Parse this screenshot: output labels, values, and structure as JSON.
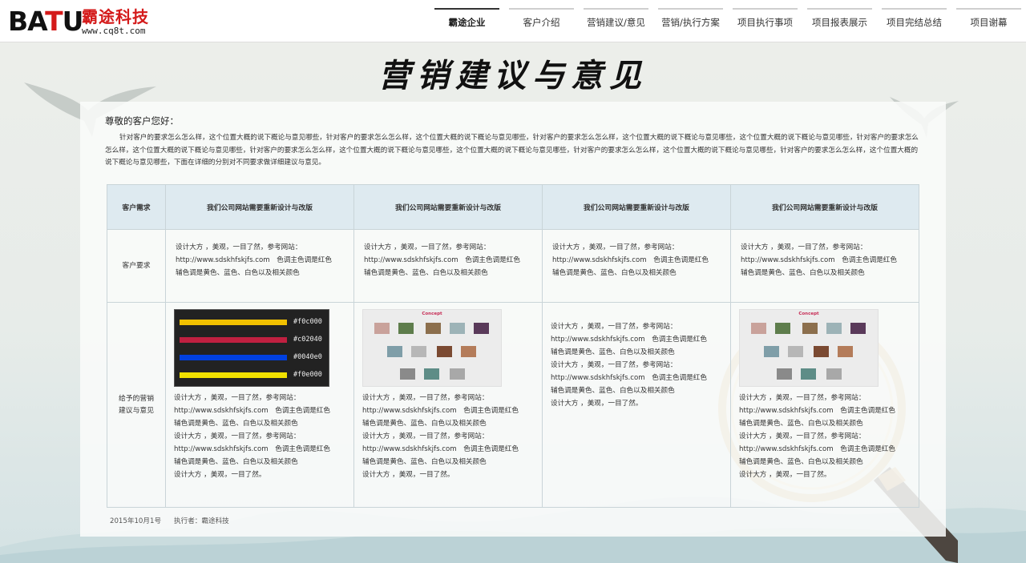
{
  "brand": {
    "logo_text_a": "BA",
    "logo_text_t": "T",
    "logo_text_u": "U",
    "name_cn": "霸途科技",
    "url": "www.cq8t.com"
  },
  "nav": {
    "items": [
      {
        "label": "霸途企业",
        "active": true
      },
      {
        "label": "客户介绍"
      },
      {
        "label": "营销建议/意见"
      },
      {
        "label": "营销/执行方案"
      },
      {
        "label": "项目执行事项"
      },
      {
        "label": "项目报表展示"
      },
      {
        "label": "项目完结总结"
      },
      {
        "label": "项目谢幕"
      }
    ]
  },
  "page": {
    "title": "营销建议与意见",
    "greeting": "尊敬的客户您好：",
    "intro": "针对客户的要求怎么怎么样，这个位置大概的说下概论与意见哪些，针对客户的要求怎么怎么样，这个位置大概的说下概论与意见哪些，针对客户的要求怎么怎么样，这个位置大概的说下概论与意见哪些，这个位置大概的说下概论与意见哪些，针对客户的要求怎么怎么样，这个位置大概的说下概论与意见哪些，针对客户的要求怎么怎么样，这个位置大概的说下概论与意见哪些，这个位置大概的说下概论与意见哪些，针对客户的要求怎么怎么样，这个位置大概的说下概论与意见哪些，针对客户的要求怎么怎么样，这个位置大概的说下概论与意见哪些，下面在详细的分别对不同要求做详细建议与意见。"
  },
  "table": {
    "row_labels": {
      "need": "客户需求",
      "requirement": "客户要求",
      "suggestion": "给予的营销建议与意见"
    },
    "headers": [
      "我们公司网站需要重新设计与改版",
      "我们公司网站需要重新设计与改版",
      "我们公司网站需要重新设计与改版",
      "我们公司网站需要重新设计与改版"
    ],
    "requirement_lines": [
      "设计大方 ，美观，一目了然，参考网站：",
      "http://www.sdskhfskjfs.com　色调主色调是红色",
      "辅色调是黄色、蓝色、白色以及相关颜色"
    ],
    "suggestion_lines": [
      "设计大方 ，美观，一目了然，参考网站：",
      "http://www.sdskhfskjfs.com　色调主色调是红色",
      "辅色调是黄色、蓝色、白色以及相关颜色",
      "设计大方 ，美观，一目了然，参考网站：",
      "http://www.sdskhfskjfs.com　色调主色调是红色",
      "辅色调是黄色、蓝色、白色以及相关颜色",
      "设计大方 ，美观，一目了然。"
    ],
    "swatches": [
      {
        "color": "#f0c000",
        "label": "#f0c000"
      },
      {
        "color": "#c02040",
        "label": "#c02040"
      },
      {
        "color": "#0040e0",
        "label": "#0040e0"
      },
      {
        "color": "#f0e000",
        "label": "#f0e000"
      }
    ],
    "concept_title": "Concept"
  },
  "footer": {
    "date": "2015年10月1号",
    "executor": "执行者：霸途科技"
  },
  "colors": {
    "brand_red": "#d41a1a",
    "header_bg": "#deeaf0"
  }
}
